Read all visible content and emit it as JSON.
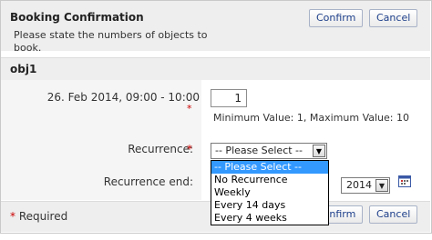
{
  "dialog": {
    "title": "Booking Confirmation",
    "subtitle": "Please state the numbers of objects to book.",
    "confirm_label": "Confirm",
    "cancel_label": "Cancel"
  },
  "object": {
    "name": "obj1",
    "date_range": "26. Feb 2014, 09:00 - 10:00",
    "quantity": "1",
    "min_max_hint": "Minimum Value: 1, Maximum Value: 10",
    "required_star": "*"
  },
  "recurrence": {
    "label": "Recurrence:",
    "selected": "-- Please Select --",
    "options": [
      "-- Please Select --",
      "No Recurrence",
      "Weekly",
      "Every 14 days",
      "Every 4 weeks"
    ]
  },
  "recurrence_end": {
    "label": "Recurrence end:",
    "year": "2014"
  },
  "footer": {
    "required_star": "*",
    "required_text": " Required",
    "confirm_label": "Confirm",
    "cancel_label": "Cancel"
  },
  "colors": {
    "header_bg": "#eeeeee",
    "button_text": "#1d3f8a",
    "required_star": "#cc0000",
    "dropdown_highlight": "#3399ff"
  },
  "icons": {
    "select_arrow": "dropdown-arrow-icon",
    "calendar": "calendar-icon"
  }
}
